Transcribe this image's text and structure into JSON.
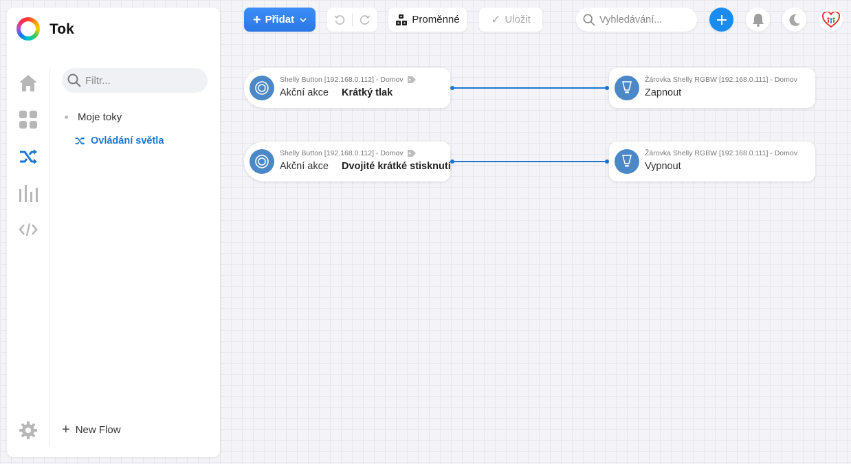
{
  "sidebar": {
    "title": "Tok",
    "filter_placeholder": "Filtr...",
    "tree_root": "Moje toky",
    "tree_item": "Ovládání světla",
    "new_flow": "New Flow",
    "rail_icons": [
      "home-icon",
      "dashboard-icon",
      "flows-icon",
      "insights-icon",
      "code-icon",
      "settings-icon"
    ]
  },
  "toolbar": {
    "add_label": "Přidat",
    "variables_label": "Proměnné",
    "save_label": "Uložit",
    "search_placeholder": "Vyhledávání..."
  },
  "colors": {
    "accent": "#1976d2",
    "add_button": "#2f80ed",
    "node_icon": "#4a88c7"
  },
  "flow": {
    "cards": [
      {
        "device": "Shelly Button [192.168.0.112] - Domov",
        "title": "Akční akce",
        "arg": "Krátký tlak"
      },
      {
        "device": "Žárovka Shelly RGBW [192.168.0.111] - Domov",
        "title": "Zapnout"
      },
      {
        "device": "Shelly Button [192.168.0.112] - Domov",
        "title": "Akční akce",
        "arg": "Dvojité krátké stisknutí"
      },
      {
        "device": "Žárovka Shelly RGBW [192.168.0.111] - Domov",
        "title": "Vypnout"
      }
    ]
  }
}
